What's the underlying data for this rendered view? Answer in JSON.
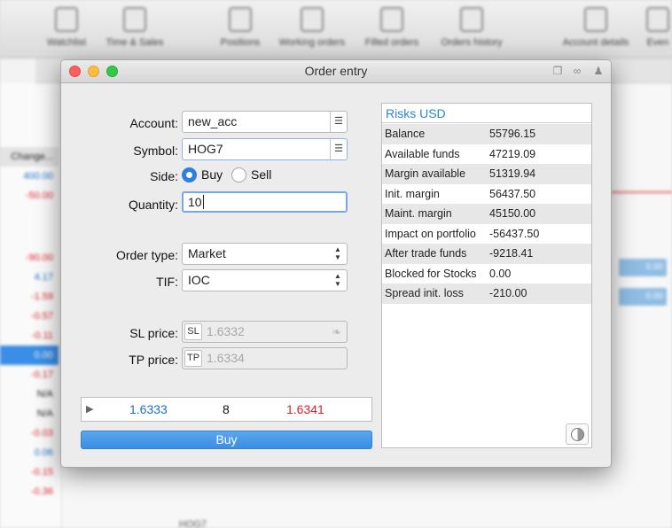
{
  "background": {
    "toolbar": [
      {
        "label": "Watchlist"
      },
      {
        "label": "Time & Sales"
      },
      {
        "label": "Positions"
      },
      {
        "label": "Working orders"
      },
      {
        "label": "Filled orders"
      },
      {
        "label": "Orders history"
      },
      {
        "label": "Account details"
      },
      {
        "label": "Even"
      }
    ],
    "changes_header": "Change...",
    "changes": [
      "400.00",
      "-50.00",
      "-90.00",
      "4.17",
      "-1.59",
      "-0.57",
      "-0.11",
      "0.00",
      "-0.17",
      "N/A",
      "N/A",
      "-0.03",
      "0.06",
      "-0.15",
      "-0.36"
    ],
    "right_badges": [
      "0.00",
      "0.00"
    ],
    "bottom_label": "HOG7"
  },
  "dialog": {
    "title": "Order entry",
    "form": {
      "account_label": "Account:",
      "account_value": "new_acc",
      "symbol_label": "Symbol:",
      "symbol_value": "HOG7",
      "side_label": "Side:",
      "side_buy": "Buy",
      "side_sell": "Sell",
      "side_selected": "Buy",
      "quantity_label": "Quantity:",
      "quantity_value": "10",
      "order_type_label": "Order type:",
      "order_type_value": "Market",
      "tif_label": "TIF:",
      "tif_value": "IOC",
      "sl_label": "SL price:",
      "sl_prefix": "SL",
      "sl_value": "1.6332",
      "tp_label": "TP price:",
      "tp_prefix": "TP",
      "tp_value": "1.6334"
    },
    "quote": {
      "bid": "1.6333",
      "size": "8",
      "ask": "1.6341",
      "bid_color": "#1a6fce",
      "ask_color": "#d8232a"
    },
    "buy_button": "Buy",
    "risks": {
      "title": "Risks USD",
      "rows": [
        {
          "label": "Balance",
          "value": "55796.15"
        },
        {
          "label": "Available funds",
          "value": "47219.09"
        },
        {
          "label": "Margin available",
          "value": "51319.94"
        },
        {
          "label": "Init. margin",
          "value": "56437.50"
        },
        {
          "label": "Maint. margin",
          "value": "45150.00"
        },
        {
          "label": "Impact on portfolio",
          "value": "-56437.50"
        },
        {
          "label": "After trade funds",
          "value": "-9218.41"
        },
        {
          "label": "Blocked for Stocks",
          "value": "0.00"
        },
        {
          "label": "Spread init. loss",
          "value": "-210.00"
        }
      ]
    }
  },
  "colors": {
    "accent": "#3b8ee2",
    "risk_title": "#2a86d6",
    "negative": "#d8232a",
    "positive": "#1a6fce"
  }
}
